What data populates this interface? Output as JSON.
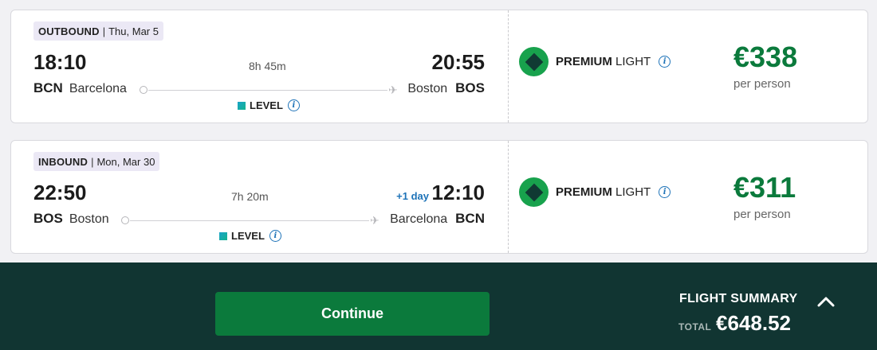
{
  "flights": [
    {
      "direction": "OUTBOUND",
      "date": "Thu, Mar 5",
      "dep_time": "18:10",
      "arr_time": "20:55",
      "plus_day": "",
      "duration": "8h 45m",
      "from_code": "BCN",
      "from_city": "Barcelona",
      "to_code": "BOS",
      "to_city": "Boston",
      "carrier_label": "LEVEL",
      "fare_bold": "PREMIUM",
      "fare_light": "LIGHT",
      "price": "€338",
      "price_note": "per person"
    },
    {
      "direction": "INBOUND",
      "date": "Mon, Mar 30",
      "dep_time": "22:50",
      "arr_time": "12:10",
      "plus_day": "+1 day",
      "duration": "7h 20m",
      "from_code": "BOS",
      "from_city": "Boston",
      "to_code": "BCN",
      "to_city": "Barcelona",
      "carrier_label": "LEVEL",
      "fare_bold": "PREMIUM",
      "fare_light": "LIGHT",
      "price": "€311",
      "price_note": "per person"
    }
  ],
  "footer": {
    "continue_label": "Continue",
    "summary_title": "FLIGHT SUMMARY",
    "total_label": "TOTAL",
    "total_value": "€648.52"
  },
  "colors": {
    "price_green": "#0b7a3c",
    "fare_badge": "#18a24d",
    "footer_bg": "#113532",
    "accent_blue": "#1e73b8"
  },
  "icons": {
    "info": "info-icon",
    "plane": "plane-icon",
    "fare": "fare-diamond-icon",
    "chevron": "chevron-up-icon"
  }
}
